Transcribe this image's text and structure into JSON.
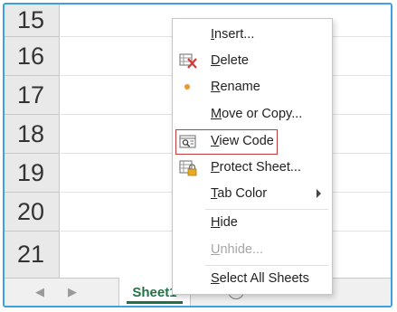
{
  "rows": [
    "15",
    "16",
    "17",
    "18",
    "19",
    "20",
    "21"
  ],
  "context_menu": {
    "items": [
      {
        "prefix": "",
        "accel": "I",
        "rest": "nsert...",
        "icon": "none-icon",
        "disabled": false
      },
      {
        "prefix": "",
        "accel": "D",
        "rest": "elete",
        "icon": "delete-sheet-icon",
        "disabled": false
      },
      {
        "prefix": "",
        "accel": "R",
        "rest": "ename",
        "icon": "bullet-icon",
        "disabled": false
      },
      {
        "prefix": "",
        "accel": "M",
        "rest": "ove or Copy...",
        "icon": "none-icon",
        "disabled": false
      },
      {
        "prefix": "",
        "accel": "V",
        "rest": "iew Code",
        "icon": "view-code-icon",
        "disabled": false,
        "highlighted": true
      },
      {
        "prefix": "",
        "accel": "P",
        "rest": "rotect Sheet...",
        "icon": "protect-sheet-icon",
        "disabled": false
      },
      {
        "prefix": "",
        "accel": "T",
        "rest": "ab Color",
        "icon": "none-icon",
        "disabled": false,
        "submenu": true
      },
      {
        "prefix": "",
        "accel": "H",
        "rest": "ide",
        "icon": "none-icon",
        "disabled": false
      },
      {
        "prefix": "",
        "accel": "U",
        "rest": "nhide...",
        "icon": "none-icon",
        "disabled": true
      },
      {
        "prefix": "",
        "accel": "S",
        "rest": "elect All Sheets",
        "icon": "none-icon",
        "disabled": false
      }
    ]
  },
  "tabbar": {
    "prev_arrow": "◀",
    "next_arrow": "▶",
    "active_sheet": "Sheet1"
  },
  "colors": {
    "accent_green": "#217346",
    "highlight_red": "#c0393b",
    "frame_blue": "#3fa0e0",
    "bullet_orange": "#f0962a"
  }
}
